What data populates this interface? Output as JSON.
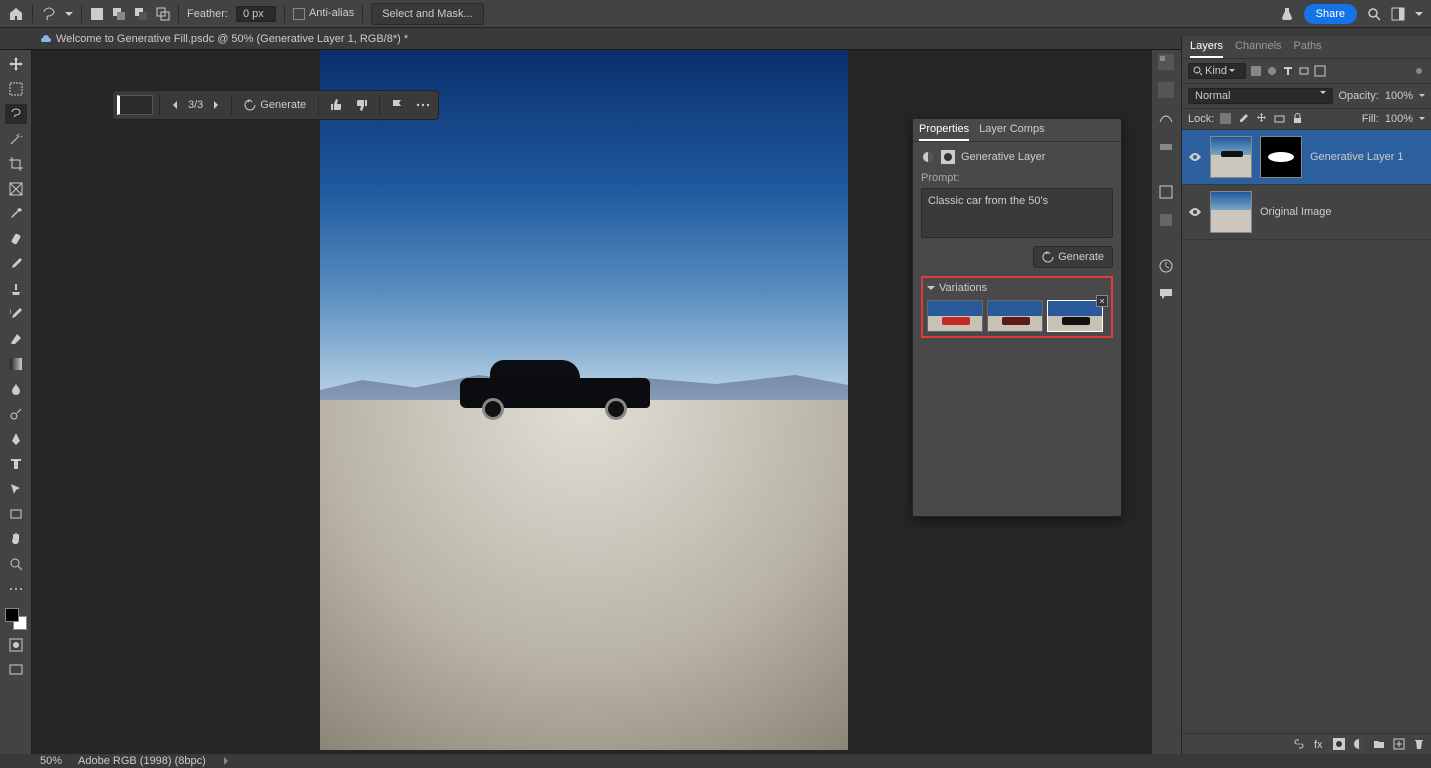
{
  "topbar": {
    "feather_label": "Feather:",
    "feather_value": "0 px",
    "antialias_label": "Anti-alias",
    "select_mask": "Select and Mask...",
    "share": "Share"
  },
  "doc_tab": "Welcome to Generative Fill.psdc @ 50% (Generative Layer 1, RGB/8*) *",
  "contextual": {
    "counter": "3/3",
    "generate": "Generate"
  },
  "properties": {
    "tab_properties": "Properties",
    "tab_layercomps": "Layer Comps",
    "layer_type": "Generative Layer",
    "prompt_label": "Prompt:",
    "prompt_value": "Classic car from the 50's",
    "generate": "Generate",
    "variations": "Variations"
  },
  "layers": {
    "tab_layers": "Layers",
    "tab_channels": "Channels",
    "tab_paths": "Paths",
    "kind": "Kind",
    "blend_mode": "Normal",
    "opacity_label": "Opacity:",
    "opacity_value": "100%",
    "lock_label": "Lock:",
    "fill_label": "Fill:",
    "fill_value": "100%",
    "items": [
      {
        "name": "Generative Layer 1"
      },
      {
        "name": "Original Image"
      }
    ]
  },
  "status": {
    "zoom": "50%",
    "profile": "Adobe RGB (1998) (8bpc)"
  },
  "icons": {
    "search": "search-icon"
  }
}
